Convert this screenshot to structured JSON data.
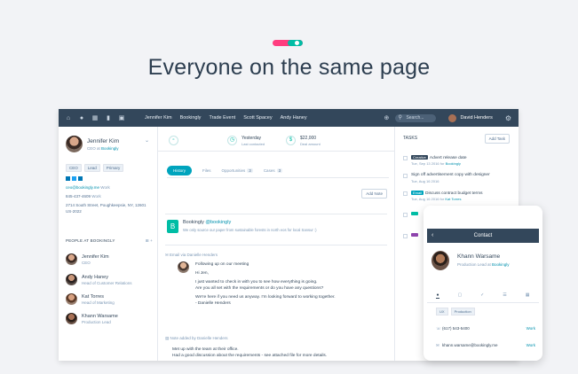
{
  "hero": {
    "headline": "Everyone on the same page"
  },
  "colors": {
    "accent_pink": "#ff3d7f",
    "accent_teal": "#00bda5",
    "nav_bg": "#33475b",
    "link": "#0091ae"
  },
  "navbar": {
    "icons": [
      "home-icon",
      "contacts-icon",
      "calendar-icon",
      "reports-icon",
      "briefcase-icon"
    ],
    "links": [
      "Jennifer Kim",
      "Bookingly",
      "Trade Event",
      "Scott Spacey",
      "Andy Haney"
    ],
    "search_placeholder": "Search...",
    "user": "David Henders"
  },
  "contact": {
    "name": "Jennifer Kim",
    "title_prefix": "CEO at",
    "company": "Bookingly",
    "tags": [
      "CEO",
      "Lead",
      "Primary"
    ],
    "email": "ceo@bookingly.me",
    "email_label": "Work",
    "phone": "845-437-4609",
    "phone_label": "Work",
    "address": "2714 South Street, Poughkeepsie, NY, 12601",
    "country": "US-2022"
  },
  "people": {
    "heading": "PEOPLE AT BOOKINGLY",
    "controls": "⊞ +",
    "items": [
      {
        "name": "Jennifer Kim",
        "role": "CEO"
      },
      {
        "name": "Andy Haney",
        "role": "Head of Customer Relations"
      },
      {
        "name": "Kat Torres",
        "role": "Head of Marketing"
      },
      {
        "name": "Khann Warsame",
        "role": "Production Lead"
      }
    ]
  },
  "stats": [
    {
      "line1": "",
      "line2": ""
    },
    {
      "line1": "Yesterday",
      "line2": "Last contacted"
    },
    {
      "line1": "$22,000",
      "line2": "Deal amount"
    },
    {
      "line1": "",
      "line2": ""
    }
  ],
  "tabs": [
    {
      "label": "History",
      "count": ""
    },
    {
      "label": "Files",
      "count": ""
    },
    {
      "label": "Opportunities",
      "count": "3"
    },
    {
      "label": "Cases",
      "count": "3"
    }
  ],
  "add_note": "Add Note",
  "brand_post": {
    "logo_letter": "B",
    "name": "Bookingly",
    "handle": "@bookingly",
    "text": "We only source our paper from sustainable forests in north eos for local Sansur :)"
  },
  "email": {
    "header": "Email via Danielle Henders",
    "subject": "Following up on our meeting",
    "greeting": "Hi Jen,",
    "body1": "I just wanted to check in with you to see how everything is going.",
    "body2": "Are you all set with the requirements or do you have any questions?",
    "body3": "We're here if you need us anyway. I'm looking forward to working together.",
    "sign": "- Danielle Henders"
  },
  "note": {
    "header": "Note added by Danielle Henders",
    "line1": "Met up with the team at their office.",
    "line2": "Had a good discussion about the requirements - see attached file for more details."
  },
  "tasks": {
    "title": "TASKS",
    "add_label": "Add Task",
    "items": [
      {
        "badge": "Creative",
        "badge_color": "#33475b",
        "label": "Advert release date",
        "date": "Tue, Sep 13 2016 for",
        "link": "Bookingly"
      },
      {
        "badge": "",
        "badge_color": "",
        "label": "Sign off advertisement copy with designer",
        "date": "Tue, Aug 16 2016",
        "link": ""
      },
      {
        "badge": "Email",
        "badge_color": "#00a4bd",
        "label": "Discuss contract budget terms",
        "date": "Tue, Aug 16 2016 for",
        "link": "Kat Torres"
      },
      {
        "badge": "",
        "badge_color": "#00bda5",
        "label": "",
        "date": "",
        "link": ""
      },
      {
        "badge": "",
        "badge_color": "#8e44ad",
        "label": "",
        "date": "",
        "link": ""
      }
    ]
  },
  "mobile": {
    "title": "Contact",
    "name": "Khann Warsame",
    "role_prefix": "Production Lead at",
    "company": "Bookingly",
    "tags": [
      "UX",
      "Production"
    ],
    "phone": "(617) 543-5400",
    "phone_action": "Work",
    "email": "khann.warsame@bookingly.me",
    "email_action": "Work"
  }
}
